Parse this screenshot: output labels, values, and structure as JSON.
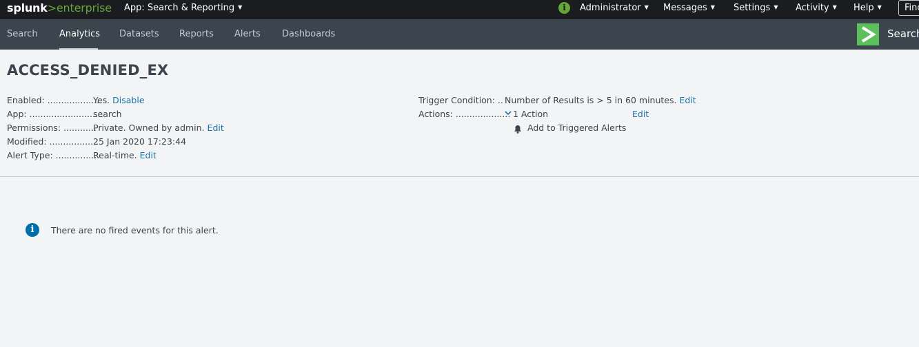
{
  "topbar": {
    "logo_splunk": "splunk",
    "logo_gt": ">",
    "logo_enterprise": "enterprise",
    "app_menu": "App: Search & Reporting",
    "info_glyph": "i",
    "items": [
      "Administrator",
      "Messages",
      "Settings",
      "Activity",
      "Help"
    ],
    "find_placeholder": "Find"
  },
  "nav": {
    "tabs": [
      "Search",
      "Analytics",
      "Datasets",
      "Reports",
      "Alerts",
      "Dashboards"
    ],
    "active_tab": "Analytics",
    "brand_label": "Search"
  },
  "alert": {
    "title": "ACCESS_DENIED_EX",
    "left_fields": [
      {
        "label": "Enabled: ....................",
        "value": "Yes.",
        "link": "Disable"
      },
      {
        "label": "App: ...........................",
        "value": "search",
        "link": ""
      },
      {
        "label": "Permissions: ............",
        "value": "Private. Owned by admin.",
        "link": "Edit"
      },
      {
        "label": "Modified: ..................",
        "value": "25 Jan 2020 17:23:44",
        "link": ""
      },
      {
        "label": "Alert Type: ................",
        "value": "Real-time.",
        "link": "Edit"
      }
    ],
    "trigger_label": "Trigger Condition: ..",
    "trigger_value": "Number of Results is > 5 in 60 minutes.",
    "trigger_link": "Edit",
    "actions_label": "Actions: ....................",
    "actions_value": "1 Action",
    "actions_link": "Edit",
    "action_item": "Add to Triggered Alerts"
  },
  "events": {
    "info_glyph": "i",
    "empty_message": "There are no fired events for this alert."
  },
  "colors": {
    "topbar": "#1a1c20",
    "navbar": "#3c444d",
    "accent_green": "#65a637",
    "link": "#1a73a8",
    "info_blue": "#006eaa"
  }
}
